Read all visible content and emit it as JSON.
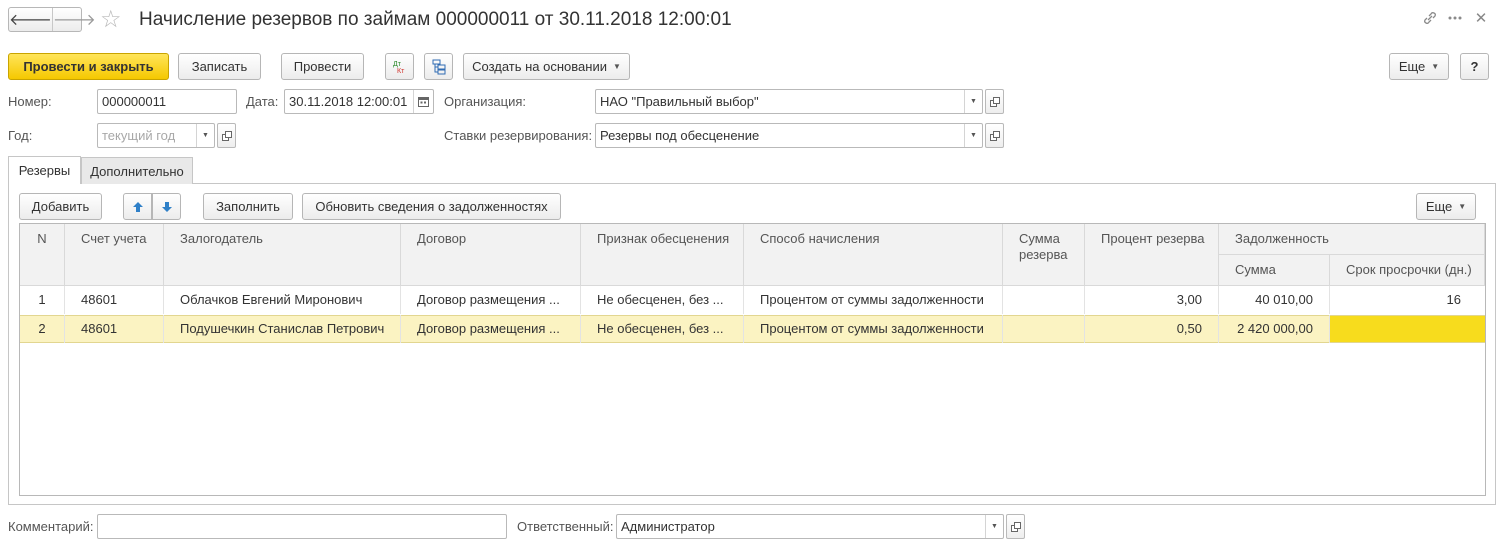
{
  "window": {
    "title": "Начисление резервов по займам 000000011 от 30.11.2018 12:00:01",
    "back_icon": "arrow-left-icon",
    "forward_icon": "arrow-right-icon",
    "favorite_icon": "star-icon"
  },
  "toolbar": {
    "post_close": "Провести и закрыть",
    "save": "Записать",
    "post": "Провести",
    "dt_kt_icon": "dt-kt-icon",
    "structure_icon": "structure-icon",
    "create_based": "Создать на основании",
    "more": "Еще",
    "help": "?"
  },
  "form": {
    "number_label": "Номер:",
    "number_value": "000000011",
    "date_label": "Дата:",
    "date_value": "30.11.2018 12:00:01",
    "org_label": "Организация:",
    "org_value": "НАО \"Правильный выбор\"",
    "year_label": "Год:",
    "year_placeholder": "текущий год",
    "rates_label": "Ставки резервирования:",
    "rates_value": "Резервы под обесценение"
  },
  "tabs": [
    {
      "label": "Резервы",
      "active": true
    },
    {
      "label": "Дополнительно",
      "active": false
    }
  ],
  "table_toolbar": {
    "add": "Добавить",
    "fill": "Заполнить",
    "update": "Обновить сведения о задолженностях",
    "more": "Еще"
  },
  "table": {
    "headers": {
      "n": "N",
      "account": "Счет учета",
      "pledger": "Залогодатель",
      "contract": "Договор",
      "impairment": "Признак обесценения",
      "method": "Способ начисления",
      "reserve_sum": "Сумма резерва",
      "reserve_pct": "Процент резерва",
      "debt": "Задолженность",
      "debt_sum": "Сумма",
      "overdue": "Срок просрочки (дн.)"
    },
    "rows": [
      {
        "n": "1",
        "account": "48601",
        "pledger": "Облачков Евгений Миронович",
        "contract": "Договор размещения ...",
        "impairment": "Не обесценен, без ...",
        "method": "Процентом от суммы задолженности",
        "reserve_sum": "",
        "reserve_pct": "3,00",
        "debt_sum": "40 010,00",
        "overdue": "16"
      },
      {
        "n": "2",
        "account": "48601",
        "pledger": "Подушечкин Станислав Петрович",
        "contract": "Договор размещения ...",
        "impairment": "Не обесценен, без ...",
        "method": "Процентом от суммы задолженности",
        "reserve_sum": "",
        "reserve_pct": "0,50",
        "debt_sum": "2 420 000,00",
        "overdue": ""
      }
    ]
  },
  "footer": {
    "comment_label": "Комментарий:",
    "comment_value": "",
    "responsible_label": "Ответственный:",
    "responsible_value": "Администратор"
  },
  "colors": {
    "primary_button": "#f5c800",
    "selected_row": "#fbf3c2",
    "active_cell": "#f7dc1d"
  }
}
